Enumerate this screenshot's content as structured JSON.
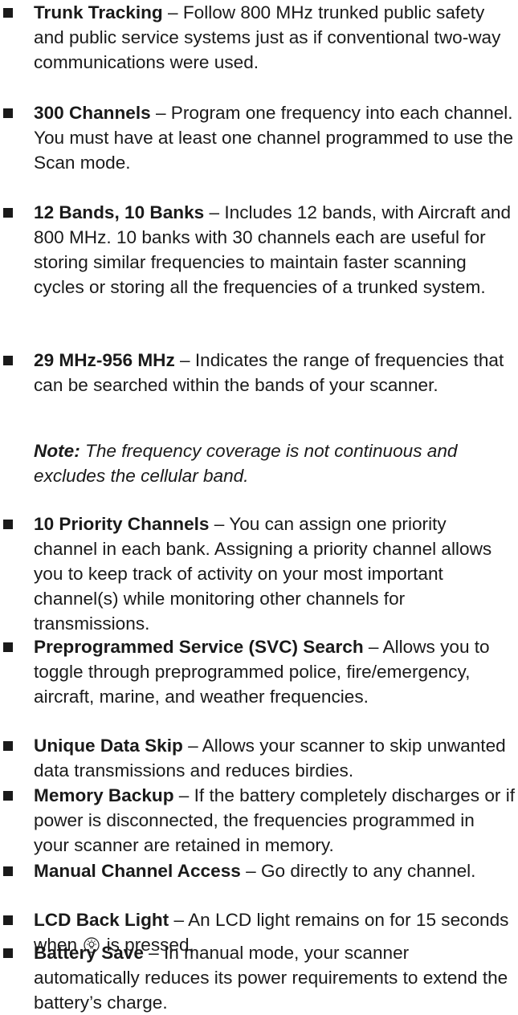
{
  "features": [
    {
      "term": "Trunk Tracking",
      "desc": " – Follow 800 MHz trunked public safety and public service systems just as if conventional two-way communications were used."
    },
    {
      "term": "300 Channels",
      "desc": " – Program one frequency into each channel. You must have at least one channel programmed to use the Scan mode."
    },
    {
      "term": "12 Bands, 10 Banks",
      "desc": " – Includes 12 bands, with Aircraft and 800 MHz. 10 banks with 30 channels each are useful for storing similar frequencies to maintain faster scanning cycles or storing all the frequencies of a trunked system."
    },
    {
      "term": "29 MHz-956 MHz",
      "desc": " – Indicates the range of frequencies that can be searched within the bands of your scanner."
    },
    {
      "term": "10 Priority Channels",
      "desc": " – You can assign one priority channel in each bank. Assigning a priority channel allows you to keep track of activity on your most important channel(s) while monitoring other channels for transmissions."
    },
    {
      "term": "Preprogrammed Service (SVC) Search",
      "desc": " – Allows you to toggle through preprogrammed police, fire/emergency, aircraft, marine, and weather frequencies."
    },
    {
      "term": "Unique Data Skip",
      "desc": " – Allows your scanner to skip unwanted data transmissions and reduces birdies."
    },
    {
      "term": "Memory Backup",
      "desc": " – If the battery completely discharges or if power is disconnected, the frequencies programmed in your scanner are retained in memory."
    },
    {
      "term": "Manual Channel Access",
      "desc": " – Go directly to any channel."
    },
    {
      "term": "LCD Back Light",
      "desc_before": " – An LCD light remains on for 15 seconds when ",
      "desc_after": " is pressed."
    },
    {
      "term": "Battery Save",
      "desc": " – In manual mode, your scanner automatically reduces its power requirements to extend the battery’s charge."
    }
  ],
  "note": {
    "label": "Note:",
    "text": " The frequency coverage is not continuous and excludes the cellular band."
  }
}
